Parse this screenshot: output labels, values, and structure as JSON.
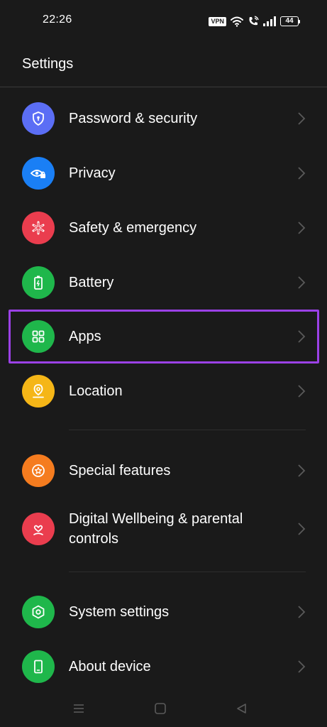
{
  "status_bar": {
    "time": "22:26",
    "vpn": "VPN",
    "battery": "44"
  },
  "header": {
    "title": "Settings"
  },
  "items": [
    {
      "label": "Password & security",
      "icon": "shield-lock-icon",
      "color": "#5b6ef5"
    },
    {
      "label": "Privacy",
      "icon": "eye-lock-icon",
      "color": "#1a7ff5"
    },
    {
      "label": "Safety & emergency",
      "icon": "asterisk-icon",
      "color": "#ea3d4e"
    },
    {
      "label": "Battery",
      "icon": "battery-icon",
      "color": "#1fb74b"
    },
    {
      "label": "Apps",
      "icon": "grid-icon",
      "color": "#1fb74b"
    },
    {
      "label": "Location",
      "icon": "location-pin-icon",
      "color": "#f5b617"
    },
    {
      "label": "Special features",
      "icon": "star-icon",
      "color": "#f57c1f"
    },
    {
      "label": "Digital Wellbeing & parental controls",
      "icon": "heart-person-icon",
      "color": "#ea3d4e"
    },
    {
      "label": "System settings",
      "icon": "hexagon-gear-icon",
      "color": "#1fb74b"
    },
    {
      "label": "About device",
      "icon": "phone-icon",
      "color": "#1fb74b"
    }
  ],
  "highlight_color": "#9b41e6"
}
